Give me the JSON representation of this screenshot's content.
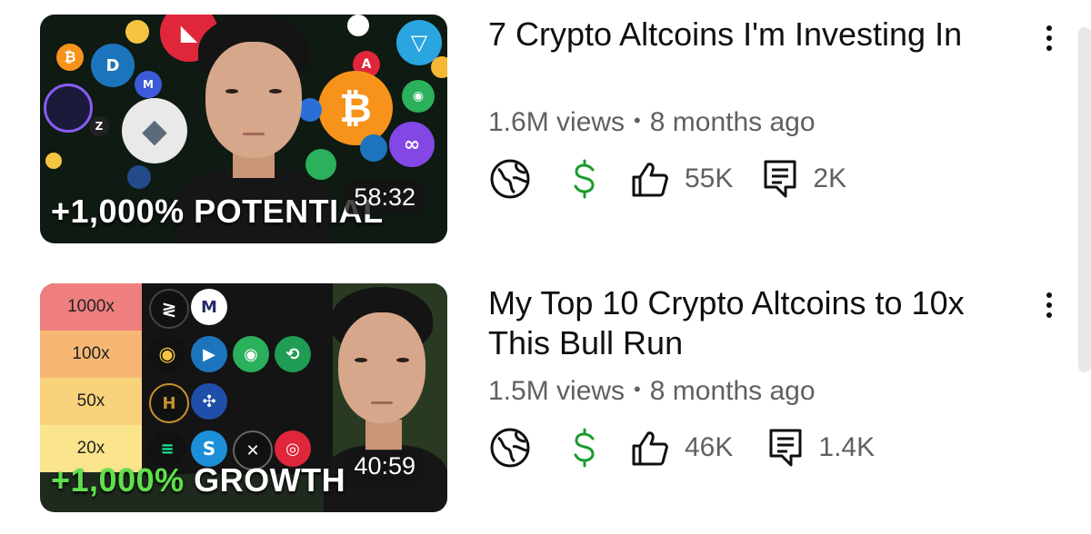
{
  "videos": [
    {
      "title": "7 Crypto Altcoins I'm Investing In",
      "views": "1.6M views",
      "age": "8 months ago",
      "duration": "58:32",
      "thumbnail_caption": "+1,000% POTENTIAL",
      "likes": "55K",
      "comments": "2K"
    },
    {
      "title": "My Top 10 Crypto Altcoins to 10x This Bull Run",
      "views": "1.5M views",
      "age": "8 months ago",
      "duration": "40:59",
      "thumbnail_caption_pct": "+1,000%",
      "thumbnail_caption_word": "GROWTH",
      "likes": "46K",
      "comments": "1.4K",
      "tiers": [
        "1000x",
        "100x",
        "50x",
        "20x"
      ]
    }
  ],
  "colors": {
    "dollar": "#1a9b2e",
    "text_primary": "#0f0f0f",
    "text_secondary": "#606060",
    "tier_1000x": "#ef7f7f",
    "tier_100x": "#f7b774",
    "tier_50x": "#f9d27c",
    "tier_20x": "#fbe58c"
  },
  "icons": {
    "globe": "globe-icon",
    "dollar": "dollar-icon",
    "like": "thumbs-up-icon",
    "comment": "comment-icon",
    "more": "more-vert-icon"
  }
}
